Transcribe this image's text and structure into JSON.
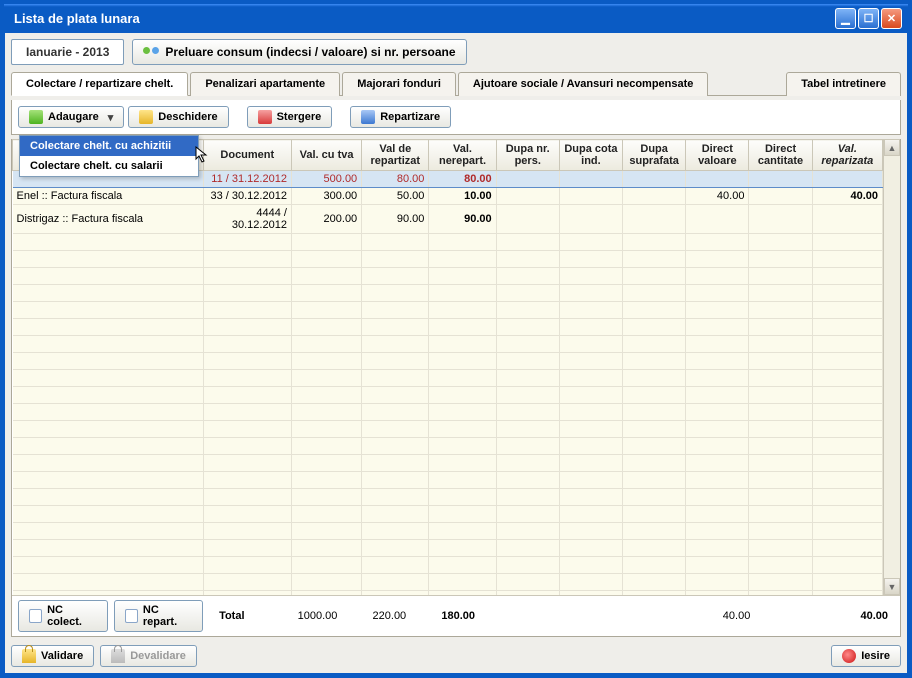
{
  "title": "Lista de plata lunara",
  "month": "Ianuarie - 2013",
  "preluare_label": "Preluare consum (indecsi / valoare) si nr. persoane",
  "tabs": [
    {
      "label": "Colectare / repartizare chelt.",
      "active": true
    },
    {
      "label": "Penalizari apartamente"
    },
    {
      "label": "Majorari fonduri"
    },
    {
      "label": "Ajutoare sociale / Avansuri necompensate"
    },
    {
      "label": "Tabel intretinere"
    }
  ],
  "toolbar": {
    "adaugare": "Adaugare",
    "deschidere": "Deschidere",
    "stergere": "Stergere",
    "repartizare": "Repartizare"
  },
  "dropdown": {
    "item1": "Colectare chelt. cu achizitii",
    "item2": "Colectare chelt. cu salarii"
  },
  "columns": {
    "doc": "Document",
    "valtva": "Val. cu tva",
    "valrep": "Val de repartizat",
    "valnerep": "Val. nerepart.",
    "dupapers": "Dupa nr. pers.",
    "dupacota": "Dupa cota ind.",
    "dupasup": "Dupa suprafata",
    "directval": "Direct valoare",
    "directcant": "Direct cantitate",
    "valrepz": "Val. reparizata"
  },
  "rows": [
    {
      "label": "",
      "doc": "11 / 31.12.2012",
      "valtva": "500.00",
      "valrep": "80.00",
      "valnerep": "80.00",
      "dupapers": "",
      "dupacota": "",
      "dupasup": "",
      "directval": "",
      "directcant": "",
      "valrepz": ""
    },
    {
      "label": "Enel :: Factura fiscala",
      "doc": "33 / 30.12.2012",
      "valtva": "300.00",
      "valrep": "50.00",
      "valnerep": "10.00",
      "dupapers": "",
      "dupacota": "",
      "dupasup": "",
      "directval": "40.00",
      "directcant": "",
      "valrepz": "40.00"
    },
    {
      "label": "Distrigaz :: Factura fiscala",
      "doc": "4444 / 30.12.2012",
      "valtva": "200.00",
      "valrep": "90.00",
      "valnerep": "90.00",
      "dupapers": "",
      "dupacota": "",
      "dupasup": "",
      "directval": "",
      "directcant": "",
      "valrepz": ""
    }
  ],
  "bottom": {
    "nc_colect": "NC colect.",
    "nc_repart": "NC repart.",
    "total_label": "Total",
    "t_valtva": "1000.00",
    "t_valrep": "220.00",
    "t_valnerep": "180.00",
    "t_directval": "40.00",
    "t_valrepz": "40.00"
  },
  "footer": {
    "validare": "Validare",
    "devalidare": "Devalidare",
    "iesire": "Iesire"
  }
}
